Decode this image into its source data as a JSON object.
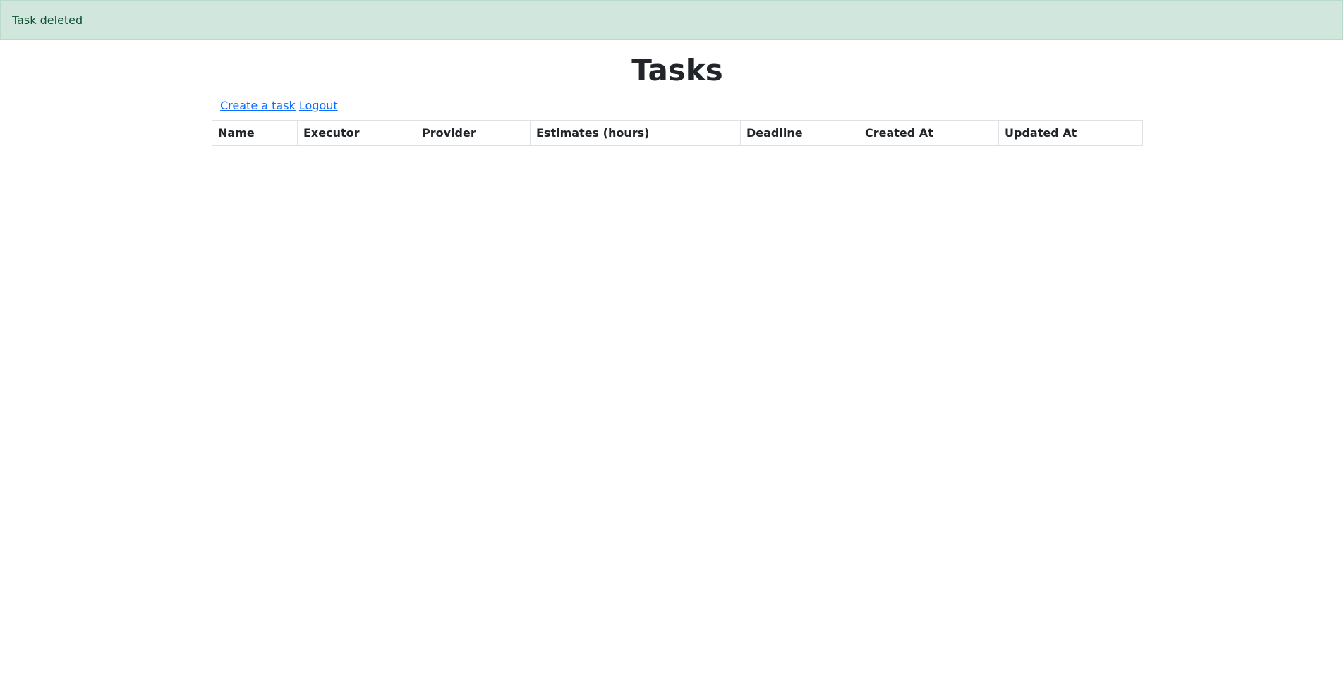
{
  "flash": {
    "message": "Task deleted",
    "color": "#d1e7dd"
  },
  "page": {
    "title": "Tasks"
  },
  "actions": {
    "create_label": "Create a task",
    "logout_label": "Logout"
  },
  "table": {
    "columns": [
      "Name",
      "Executor",
      "Provider",
      "Estimates (hours)",
      "Deadline",
      "Created At",
      "Updated At"
    ],
    "rows": []
  },
  "colors": {
    "link": "#0d6efd",
    "flash_text": "#0f5132"
  }
}
